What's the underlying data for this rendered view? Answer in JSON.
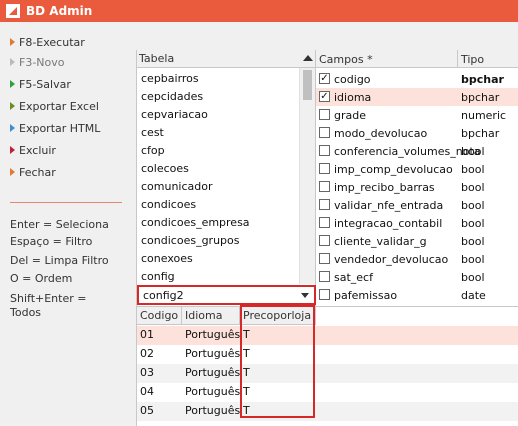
{
  "app": {
    "title": "BD Admin"
  },
  "menu": [
    {
      "label": "F8-Executar",
      "enabled": true,
      "color": "orange"
    },
    {
      "label": "F3-Novo",
      "enabled": false,
      "color": "gray"
    },
    {
      "label": "F5-Salvar",
      "enabled": true,
      "color": "green"
    },
    {
      "label": "Exportar Excel",
      "enabled": true,
      "color": "olive"
    },
    {
      "label": "Exportar HTML",
      "enabled": true,
      "color": "blue"
    },
    {
      "label": "Excluir",
      "enabled": true,
      "color": "red"
    },
    {
      "label": "Fechar",
      "enabled": true,
      "color": "orange"
    }
  ],
  "help": {
    "line1": "Enter = Seleciona",
    "line2": "Espaço = Filtro",
    "line3": "Del = Limpa Filtro",
    "line4": "O  =  Ordem",
    "line5": "Shift+Enter =",
    "line6": "Todos"
  },
  "tabela": {
    "header": "Tabela",
    "items": [
      "cepbairros",
      "cepcidades",
      "cepvariacao",
      "cest",
      "cfop",
      "colecoes",
      "comunicador",
      "condicoes",
      "condicoes_empresa",
      "condicoes_grupos",
      "conexoes",
      "config"
    ],
    "selected": "config2"
  },
  "campos": {
    "header": "Campos *",
    "tipo_header": "Tipo",
    "rows": [
      {
        "name": "codigo",
        "type": "bpchar",
        "checked": true,
        "selected": false,
        "bold": true
      },
      {
        "name": "idioma",
        "type": "bpchar",
        "checked": true,
        "selected": true,
        "bold": false
      },
      {
        "name": "grade",
        "type": "numeric",
        "checked": false,
        "selected": false,
        "bold": false
      },
      {
        "name": "modo_devolucao",
        "type": "bpchar",
        "checked": false,
        "selected": false,
        "bold": false
      },
      {
        "name": "conferencia_volumes_nota",
        "type": "bool",
        "checked": false,
        "selected": false,
        "bold": false
      },
      {
        "name": "imp_comp_devolucao",
        "type": "bool",
        "checked": false,
        "selected": false,
        "bold": false
      },
      {
        "name": "imp_recibo_barras",
        "type": "bool",
        "checked": false,
        "selected": false,
        "bold": false
      },
      {
        "name": "validar_nfe_entrada",
        "type": "bool",
        "checked": false,
        "selected": false,
        "bold": false
      },
      {
        "name": "integracao_contabil",
        "type": "bool",
        "checked": false,
        "selected": false,
        "bold": false
      },
      {
        "name": "cliente_validar_g",
        "type": "bool",
        "checked": false,
        "selected": false,
        "bold": false
      },
      {
        "name": "vendedor_devolucao",
        "type": "bool",
        "checked": false,
        "selected": false,
        "bold": false
      },
      {
        "name": "sat_ecf",
        "type": "bool",
        "checked": false,
        "selected": false,
        "bold": false
      },
      {
        "name": "pafemissao",
        "type": "date",
        "checked": false,
        "selected": false,
        "bold": false
      }
    ]
  },
  "grid": {
    "columns": [
      "Codigo",
      "Idioma",
      "Precoporloja"
    ],
    "rows": [
      [
        "01",
        "Português",
        "T"
      ],
      [
        "02",
        "Português",
        "T"
      ],
      [
        "03",
        "Português",
        "T"
      ],
      [
        "04",
        "Português",
        "T"
      ],
      [
        "05",
        "Português",
        "T"
      ]
    ]
  },
  "colors": {
    "accent": "#ea5a3c",
    "selection": "#fde2db",
    "highlight": "#d62828"
  }
}
